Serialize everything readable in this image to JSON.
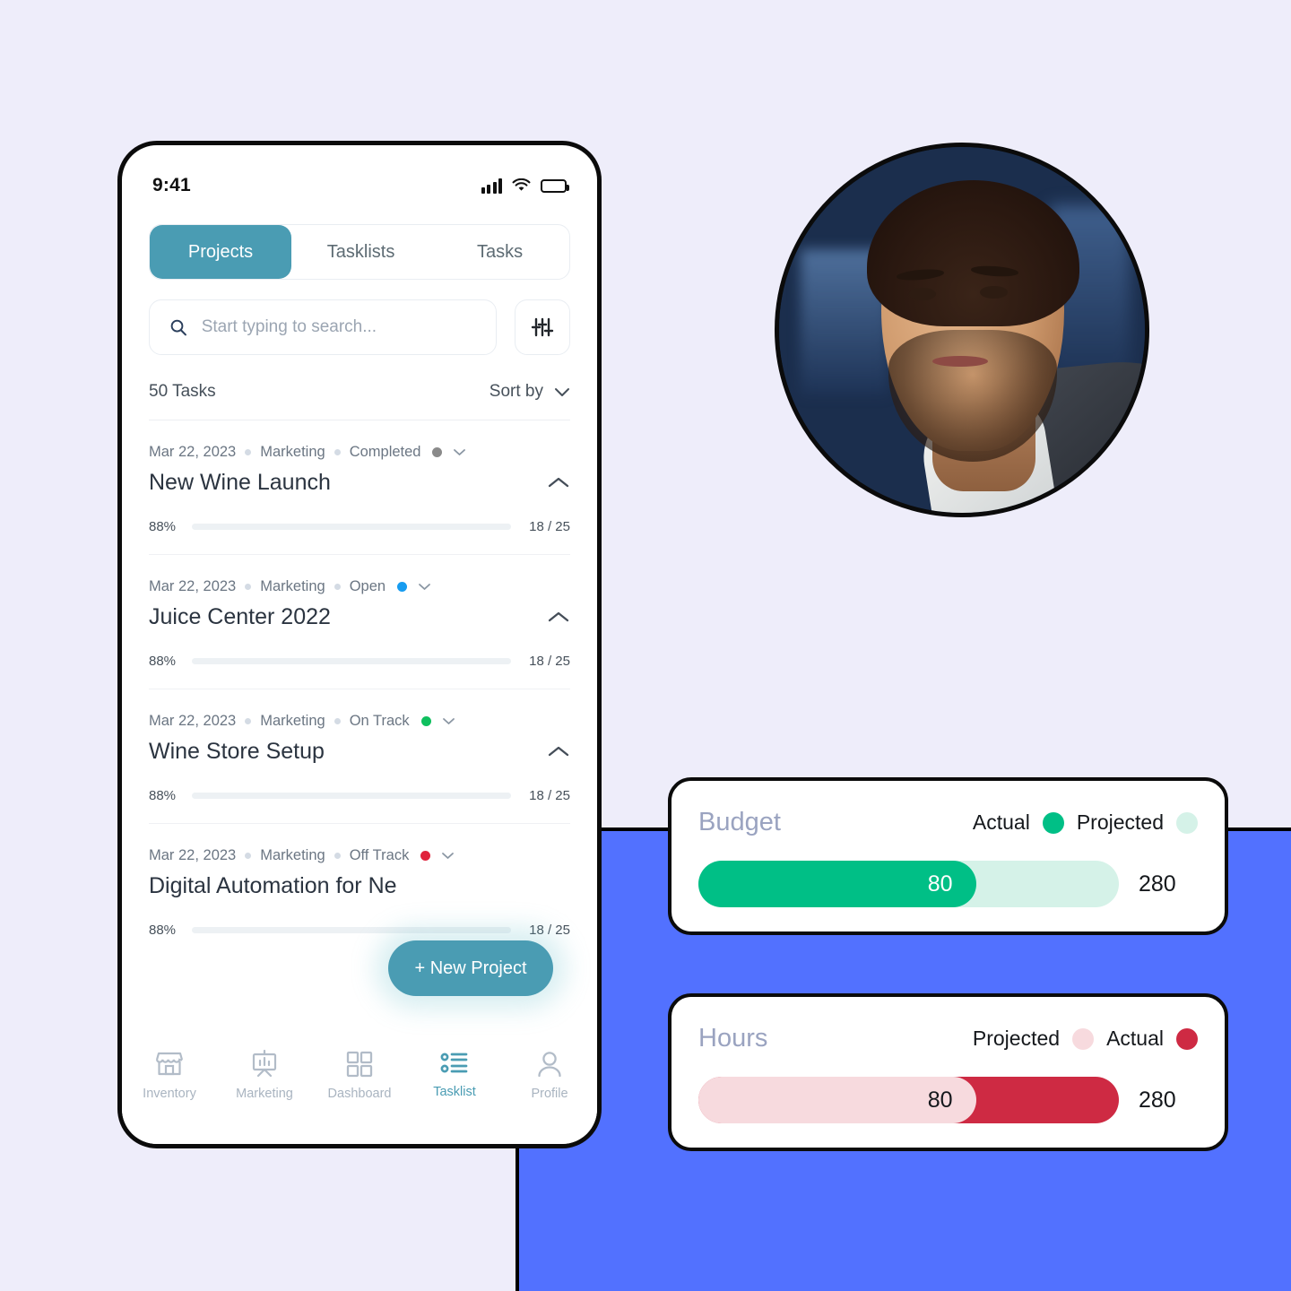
{
  "colors": {
    "page_background": "#EEEDFA",
    "panel_blue": "#5271FF",
    "accent_teal": "#4A9CB3",
    "green_actual": "#00BF86",
    "green_projected": "#D5F2E8",
    "red_actual": "#CE2A43",
    "pink_projected": "#F7DADE",
    "status_open_blue": "#179CF0",
    "status_ontrack_green": "#0FBF5E",
    "status_offtrack_red": "#E0233C",
    "status_completed_gray": "#8A8A8A"
  },
  "phone": {
    "status_bar": {
      "time": "9:41",
      "signal_icon": "cellular-signal-icon",
      "wifi_icon": "wifi-icon",
      "battery_icon": "battery-full-icon"
    },
    "tabs": [
      {
        "label": "Projects",
        "active": true
      },
      {
        "label": "Tasklists",
        "active": false
      },
      {
        "label": "Tasks",
        "active": false
      }
    ],
    "search": {
      "placeholder": "Start typing to search...",
      "value": "",
      "icon": "search-icon",
      "filter_icon": "filter-sliders-icon"
    },
    "list_header": {
      "count_label": "50 Tasks",
      "sort_label": "Sort by",
      "sort_icon": "chevron-down-icon"
    },
    "projects": [
      {
        "date": "Mar 22, 2023",
        "category": "Marketing",
        "status": "Completed",
        "status_color": "#8A8A8A",
        "title": "New Wine Launch",
        "percent": "88%",
        "percent_value": 88,
        "count": "18 / 25",
        "collapse_icon": "chevron-up-icon"
      },
      {
        "date": "Mar 22, 2023",
        "category": "Marketing",
        "status": "Open",
        "status_color": "#179CF0",
        "title": "Juice Center 2022",
        "percent": "88%",
        "percent_value": 88,
        "count": "18 / 25",
        "collapse_icon": "chevron-up-icon"
      },
      {
        "date": "Mar 22, 2023",
        "category": "Marketing",
        "status": "On Track",
        "status_color": "#0FBF5E",
        "title": "Wine Store Setup",
        "percent": "88%",
        "percent_value": 88,
        "count": "18 / 25",
        "collapse_icon": "chevron-up-icon"
      },
      {
        "date": "Mar 22, 2023",
        "category": "Marketing",
        "status": "Off Track",
        "status_color": "#E0233C",
        "title": "Digital Automation for Ne",
        "percent": "88%",
        "percent_value": 88,
        "count": "18 / 25",
        "collapse_icon": "chevron-up-icon"
      }
    ],
    "fab": {
      "label": "+ New Project"
    },
    "bottom_nav": [
      {
        "label": "Inventory",
        "icon": "store-icon",
        "active": false
      },
      {
        "label": "Marketing",
        "icon": "presentation-icon",
        "active": false
      },
      {
        "label": "Dashboard",
        "icon": "grid-icon",
        "active": false
      },
      {
        "label": "Tasklist",
        "icon": "list-icon",
        "active": true
      },
      {
        "label": "Profile",
        "icon": "person-icon",
        "active": false
      }
    ]
  },
  "avatar": {
    "alt": "profile-photo-man-in-suit"
  },
  "metric_cards": [
    {
      "title": "Budget",
      "legend": [
        {
          "label": "Actual",
          "color": "#00BF86"
        },
        {
          "label": "Projected",
          "color": "#D5F2E8"
        }
      ],
      "front_bar": {
        "label": "80",
        "value": 80,
        "color": "#00BF86",
        "text_color": "#FFFFFF"
      },
      "back_bar": {
        "value": 280,
        "color": "#D5F2E8"
      },
      "total_label": "280"
    },
    {
      "title": "Hours",
      "legend": [
        {
          "label": "Projected",
          "color": "#F7DADE"
        },
        {
          "label": "Actual",
          "color": "#CE2A43"
        }
      ],
      "front_bar": {
        "label": "80",
        "value": 80,
        "color": "#F7DADE",
        "text_color": "#15181C"
      },
      "back_bar": {
        "value": 280,
        "color": "#CE2A43"
      },
      "total_label": "280"
    }
  ]
}
